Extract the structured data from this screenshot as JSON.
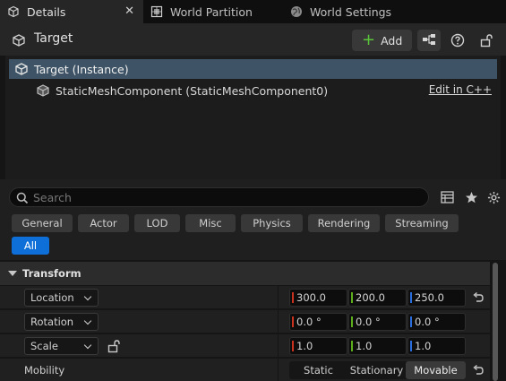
{
  "tabs": [
    {
      "label": "Details",
      "icon": "details-icon",
      "active": true
    },
    {
      "label": "World Partition",
      "icon": "world-partition-icon",
      "active": false
    },
    {
      "label": "World Settings",
      "icon": "globe-icon",
      "active": false
    }
  ],
  "tab_close": "✕",
  "header": {
    "title": "Target",
    "add_label": "Add",
    "add_symbol": "+"
  },
  "tree": {
    "root": "Target (Instance)",
    "child": "StaticMeshComponent (StaticMeshComponent0)",
    "edit_link": "Edit in C++"
  },
  "search": {
    "placeholder": "Search",
    "value": ""
  },
  "filters": [
    "General",
    "Actor",
    "LOD",
    "Misc",
    "Physics",
    "Rendering",
    "Streaming",
    "All"
  ],
  "active_filter": "All",
  "transform": {
    "section_title": "Transform",
    "rows": [
      {
        "label": "Location",
        "values": [
          "300.0",
          "200.0",
          "250.0"
        ]
      },
      {
        "label": "Rotation",
        "values": [
          "0.0 °",
          "0.0 °",
          "0.0 °"
        ]
      },
      {
        "label": "Scale",
        "values": [
          "1.0",
          "1.0",
          "1.0"
        ]
      }
    ],
    "mobility": {
      "label": "Mobility",
      "options": [
        "Static",
        "Stationary",
        "Movable"
      ],
      "selected": "Movable"
    }
  },
  "colors": {
    "selection": "#3e5466",
    "accent_blue": "#0f6fd8",
    "add_green": "#5ac43a",
    "axis_x": "#c8321e",
    "axis_y": "#5cae1c",
    "axis_z": "#2a6ee0"
  }
}
